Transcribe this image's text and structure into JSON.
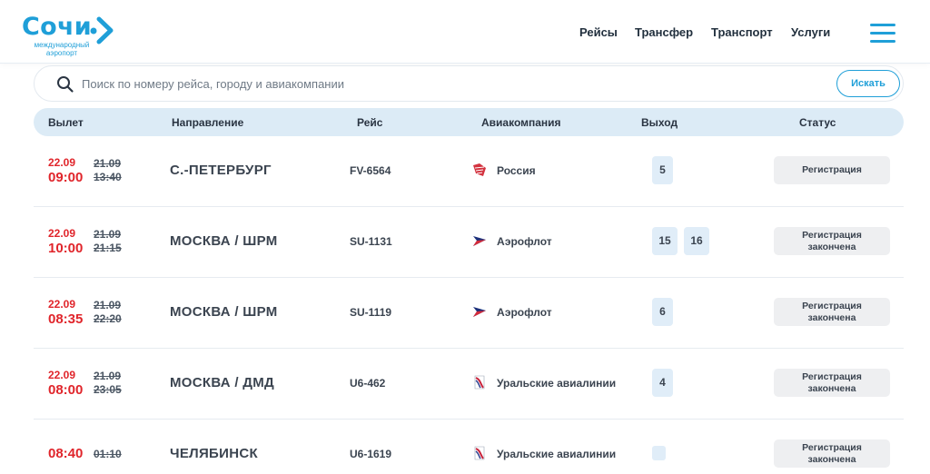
{
  "header": {
    "logo_text": "Сочи",
    "logo_subtitle": "международный аэропорт",
    "brand_color": "#1f9fd8",
    "nav": [
      "Рейсы",
      "Трансфер",
      "Транспорт",
      "Услуги"
    ]
  },
  "search": {
    "placeholder": "Поиск по номеру рейса, городу и авиакомпании",
    "button_label": "Искать"
  },
  "table": {
    "columns": [
      "Вылет",
      "Направление",
      "Рейс",
      "Авиакомпания",
      "Выход",
      "Статус"
    ]
  },
  "flights": [
    {
      "date": "22.09",
      "time": "09:00",
      "sched_date": "21.09",
      "sched_time": "13:40",
      "destination": "С.-ПЕТЕРБУРГ",
      "flight": "FV-6564",
      "airline": "Россия",
      "airline_icon": "rossiya-logo-icon",
      "gates": [
        "5"
      ],
      "status": "Регистрация"
    },
    {
      "date": "22.09",
      "time": "10:00",
      "sched_date": "21.09",
      "sched_time": "21:15",
      "destination": "МОСКВА / ШРМ",
      "flight": "SU-1131",
      "airline": "Аэрофлот",
      "airline_icon": "aeroflot-logo-icon",
      "gates": [
        "15",
        "16"
      ],
      "status": "Регистрация закончена"
    },
    {
      "date": "22.09",
      "time": "08:35",
      "sched_date": "21.09",
      "sched_time": "22:20",
      "destination": "МОСКВА / ШРМ",
      "flight": "SU-1119",
      "airline": "Аэрофлот",
      "airline_icon": "aeroflot-logo-icon",
      "gates": [
        "6"
      ],
      "status": "Регистрация закончена"
    },
    {
      "date": "22.09",
      "time": "08:00",
      "sched_date": "21.09",
      "sched_time": "23:05",
      "destination": "МОСКВА / ДМД",
      "flight": "U6-462",
      "airline": "Уральские авиалинии",
      "airline_icon": "ural-airlines-logo-icon",
      "gates": [
        "4"
      ],
      "status": "Регистрация закончена"
    },
    {
      "date": "",
      "time": "08:40",
      "sched_date": "",
      "sched_time": "01:10",
      "destination": "ЧЕЛЯБИНСК",
      "flight": "U6-1619",
      "airline": "Уральские авиалинии",
      "airline_icon": "ural-airlines-logo-icon",
      "gates": [
        ""
      ],
      "status": "Регистрация закончена"
    }
  ]
}
